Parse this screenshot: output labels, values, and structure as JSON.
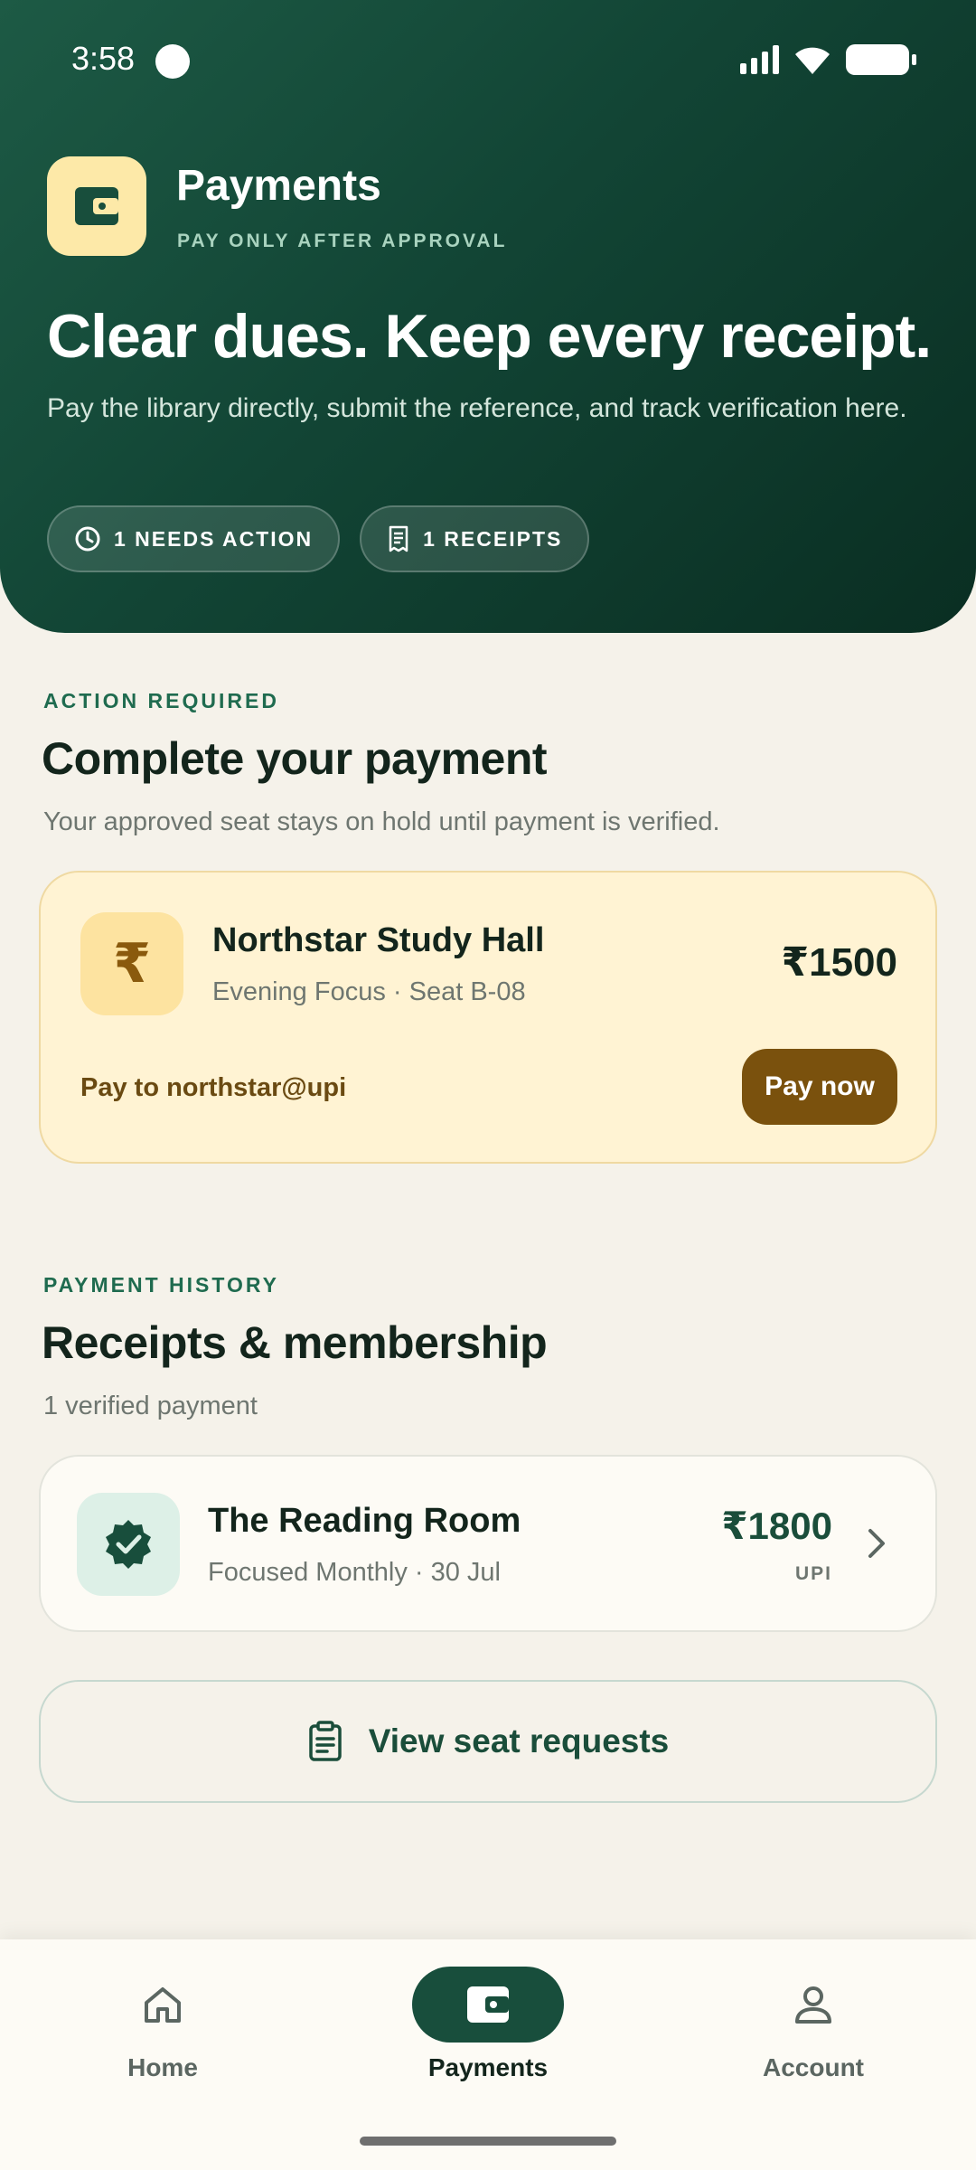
{
  "status_bar": {
    "time": "3:58"
  },
  "header": {
    "title": "Payments",
    "subtitle": "PAY ONLY AFTER APPROVAL",
    "icon": "wallet-icon"
  },
  "hero": {
    "headline": "Clear dues. Keep every receipt.",
    "description": "Pay the library directly, submit the reference, and track verification here.",
    "chips": [
      {
        "label": "1 NEEDS ACTION",
        "icon": "clock-icon"
      },
      {
        "label": "1 RECEIPTS",
        "icon": "receipt-icon"
      }
    ]
  },
  "action_section": {
    "eyebrow": "ACTION REQUIRED",
    "title": "Complete your payment",
    "subtitle": "Your approved seat stays on hold until payment is verified.",
    "card": {
      "currency_symbol": "₹",
      "library": "Northstar Study Hall",
      "plan": "Evening Focus · Seat B-08",
      "amount": "₹1500",
      "pay_to": "Pay to northstar@upi",
      "button": "Pay now"
    }
  },
  "history_section": {
    "eyebrow": "PAYMENT HISTORY",
    "title": "Receipts & membership",
    "subtitle": "1 verified payment",
    "receipts": [
      {
        "library": "The Reading Room",
        "plan": "Focused Monthly · 30 Jul",
        "amount": "₹1800",
        "method": "UPI"
      }
    ]
  },
  "seat_requests_button": {
    "label": "View seat requests",
    "icon": "clipboard-icon"
  },
  "bottom_nav": {
    "items": [
      {
        "label": "Home",
        "icon": "home-icon",
        "active": false
      },
      {
        "label": "Payments",
        "icon": "wallet-icon",
        "active": true
      },
      {
        "label": "Account",
        "icon": "person-icon",
        "active": false
      }
    ]
  },
  "colors": {
    "hero_dark": "#0a2e22",
    "hero_light": "#1d5a45",
    "accent_green": "#1a4d3a",
    "action_card_bg": "#fff3d3",
    "pay_button": "#7a510d",
    "page_bg": "#f5f2ea"
  }
}
